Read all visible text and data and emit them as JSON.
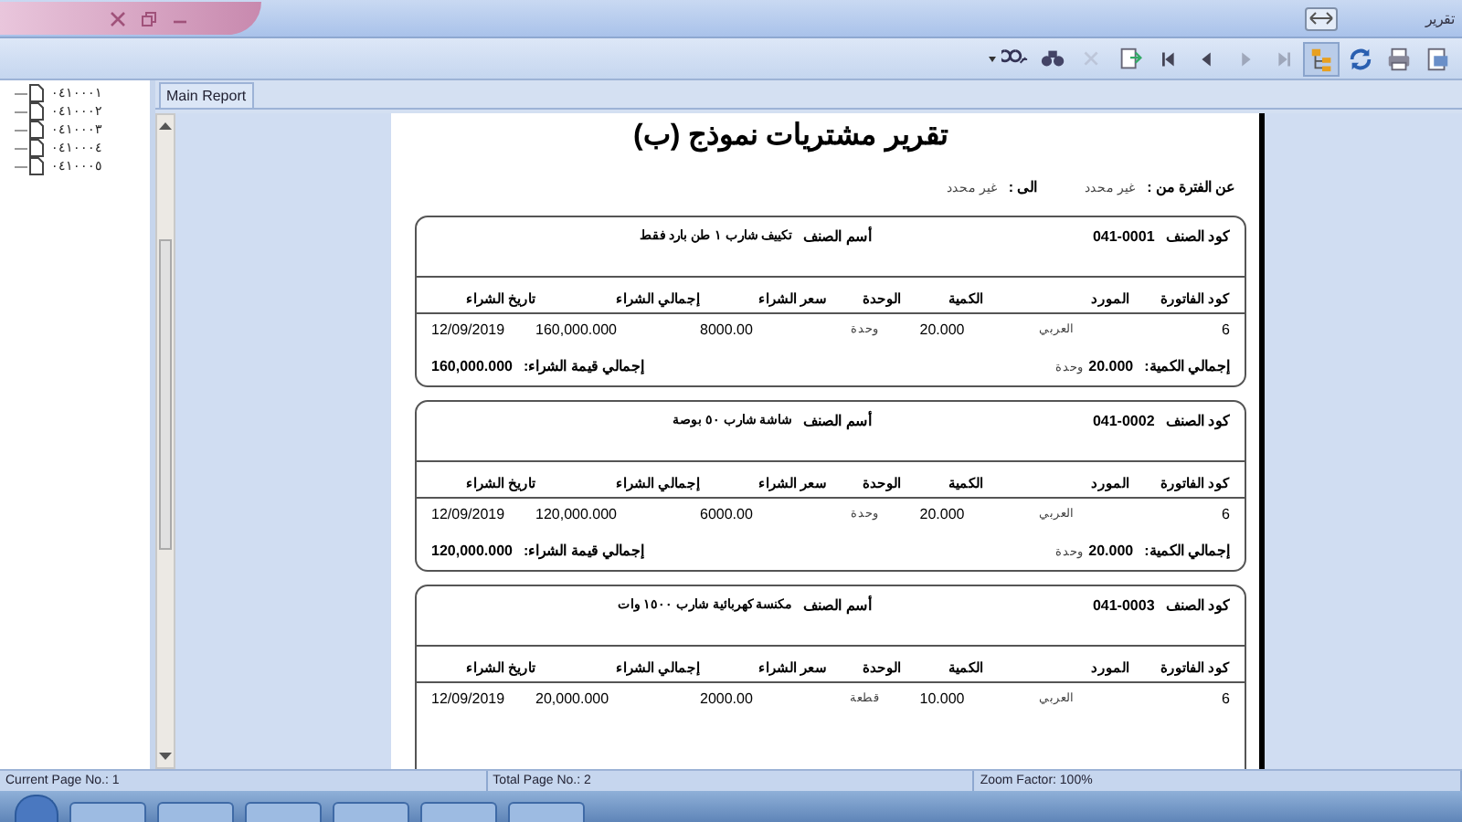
{
  "window": {
    "title": "تقرير"
  },
  "toolbar": {
    "buttons": [
      {
        "kind": "zoom",
        "selected": false,
        "disabled": false
      },
      {
        "kind": "search",
        "selected": false,
        "disabled": false
      },
      {
        "kind": "close",
        "selected": false,
        "disabled": true
      },
      {
        "kind": "export",
        "selected": false,
        "disabled": false
      },
      {
        "kind": "first",
        "selected": false,
        "disabled": false
      },
      {
        "kind": "prev",
        "selected": false,
        "disabled": false
      },
      {
        "kind": "next",
        "selected": false,
        "disabled": true
      },
      {
        "kind": "last",
        "selected": false,
        "disabled": true
      },
      {
        "kind": "tree",
        "selected": true,
        "disabled": false
      },
      {
        "kind": "refresh",
        "selected": false,
        "disabled": false
      },
      {
        "kind": "print",
        "selected": false,
        "disabled": false
      },
      {
        "kind": "setup",
        "selected": false,
        "disabled": false
      }
    ]
  },
  "tree": {
    "items": [
      {
        "label": "٠٤١٠٠٠١"
      },
      {
        "label": "٠٤١٠٠٠٢"
      },
      {
        "label": "٠٤١٠٠٠٣"
      },
      {
        "label": "٠٤١٠٠٠٤"
      },
      {
        "label": "٠٤١٠٠٠٥"
      }
    ]
  },
  "tabs": [
    {
      "label": "Main Report",
      "selected": true
    }
  ],
  "report": {
    "title": "تقرير مشتريات نموذج (ب)",
    "period_from_label": "عن الفترة من :",
    "period_from": "غير محدد",
    "period_to_label": "الى :",
    "period_to": "غير محدد",
    "items": [
      {
        "code_label": "كود الصنف",
        "code": "041-0001",
        "name_label": "أسم الصنف",
        "name": "تكييف شارب ١ طن بارد فقط",
        "columns": [
          "كود الفاتورة",
          "المورد",
          "الكمية",
          "الوحدة",
          "سعر الشراء",
          "إجمالي الشراء",
          "تاريخ الشراء"
        ],
        "rows": [
          [
            "6",
            "العربي",
            "20.000",
            "وحدة",
            "8000.00",
            "160,000.000",
            "12/09/2019"
          ]
        ],
        "totals": {
          "qty_label": "إجمالي الكمية:",
          "qty": "20.000",
          "unit": "وحدة",
          "value_label": "إجمالي قيمة الشراء:",
          "value": "160,000.000"
        }
      },
      {
        "code_label": "كود الصنف",
        "code": "041-0002",
        "name_label": "أسم الصنف",
        "name": "شاشة شارب ٥٠ بوصة",
        "columns": [
          "كود الفاتورة",
          "المورد",
          "الكمية",
          "الوحدة",
          "سعر الشراء",
          "إجمالي الشراء",
          "تاريخ الشراء"
        ],
        "rows": [
          [
            "6",
            "العربي",
            "20.000",
            "وحدة",
            "6000.00",
            "120,000.000",
            "12/09/2019"
          ]
        ],
        "totals": {
          "qty_label": "إجمالي الكمية:",
          "qty": "20.000",
          "unit": "وحدة",
          "value_label": "إجمالي قيمة الشراء:",
          "value": "120,000.000"
        }
      },
      {
        "code_label": "كود الصنف",
        "code": "041-0003",
        "name_label": "أسم الصنف",
        "name": "مكنسة كهربائية شارب ١٥٠٠ وات",
        "columns": [
          "كود الفاتورة",
          "المورد",
          "الكمية",
          "الوحدة",
          "سعر الشراء",
          "إجمالي الشراء",
          "تاريخ الشراء"
        ],
        "rows": [
          [
            "6",
            "العربي",
            "10.000",
            "قطعة",
            "2000.00",
            "20,000.000",
            "12/09/2019"
          ]
        ]
      }
    ]
  },
  "status_bar": {
    "current_page": "Current Page No.: 1",
    "total_pages": "Total Page No.: 2",
    "zoom_factor": "Zoom Factor: 100%"
  }
}
